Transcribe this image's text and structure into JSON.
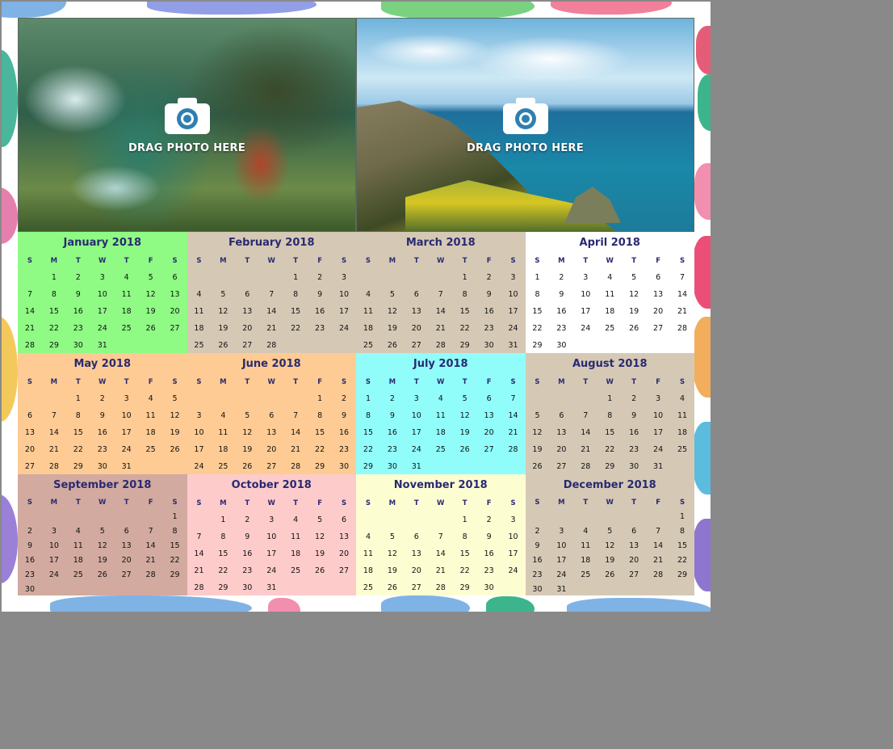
{
  "photo_slots": [
    {
      "label": "DRAG PHOTO HERE",
      "icon": "camera-icon"
    },
    {
      "label": "DRAG PHOTO HERE",
      "icon": "camera-icon"
    }
  ],
  "weekday_headers": [
    "S",
    "M",
    "T",
    "W",
    "T",
    "F",
    "S"
  ],
  "months": [
    {
      "title": "January 2018",
      "offset": 1,
      "days": 31,
      "color": "#8ffb85"
    },
    {
      "title": "February 2018",
      "offset": 4,
      "days": 28,
      "color": "#d5c9b6"
    },
    {
      "title": "March 2018",
      "offset": 4,
      "days": 31,
      "color": "#d5c9b6"
    },
    {
      "title": "April 2018",
      "offset": 0,
      "days": 30,
      "color": "#ffffff"
    },
    {
      "title": "May 2018",
      "offset": 2,
      "days": 31,
      "color": "#fecb94"
    },
    {
      "title": "June 2018",
      "offset": 5,
      "days": 30,
      "color": "#fecb94"
    },
    {
      "title": "July 2018",
      "offset": 0,
      "days": 31,
      "color": "#90fdfb"
    },
    {
      "title": "August 2018",
      "offset": 3,
      "days": 31,
      "color": "#d5c9b6"
    },
    {
      "title": "September 2018",
      "offset": 6,
      "days": 30,
      "color": "#d2aaa0"
    },
    {
      "title": "October 2018",
      "offset": 1,
      "days": 31,
      "color": "#fecbcb"
    },
    {
      "title": "November 2018",
      "offset": 4,
      "days": 30,
      "color": "#fdfdd2"
    },
    {
      "title": "December 2018",
      "offset": 6,
      "days": 31,
      "color": "#d5c9b6"
    }
  ]
}
